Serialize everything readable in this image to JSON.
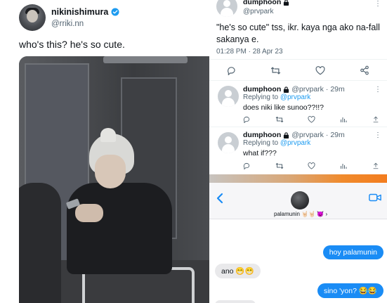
{
  "tweet": {
    "name": "nikinishimura",
    "handle": "@rriki.nn",
    "text": "who's this? he's so cute."
  },
  "thread": {
    "main": {
      "name": "dumphoon",
      "handle": "@prvpark",
      "text": "\"he's so cute\" tss, ikr. kaya nga ako na-fall sakanya e.",
      "timestamp": "01:28 PM · 28 Apr 23"
    },
    "replies": [
      {
        "name": "dumphoon",
        "handle": "@prvpark",
        "time": "· 29m",
        "replying_prefix": "Replying to ",
        "replying_to": "@prvpark",
        "text": "does niki like sunoo??!!?"
      },
      {
        "name": "dumphoon",
        "handle": "@prvpark",
        "time": "· 29m",
        "replying_prefix": "Replying to ",
        "replying_to": "@prvpark",
        "text": "what if???"
      }
    ]
  },
  "messages": {
    "contact_name": "palamunin 🤘🏻🤘🏻 😈 ›",
    "items": [
      {
        "direction": "out",
        "text": "hoy palamunin"
      },
      {
        "direction": "in",
        "text": "ano 😁😁"
      },
      {
        "direction": "out",
        "text": "sino 'yon? 😂😂"
      }
    ]
  },
  "icons": [
    "verified-badge-icon",
    "lock-icon",
    "reply-icon",
    "retweet-icon",
    "like-icon",
    "share-icon",
    "views-icon",
    "back-chevron-icon",
    "video-call-icon",
    "more-icon"
  ],
  "colors": {
    "twitter_blue": "#1d9bf0",
    "imessage_blue": "#1a8cf5",
    "muted": "#536471",
    "strip_orange": "#f37d1f"
  }
}
